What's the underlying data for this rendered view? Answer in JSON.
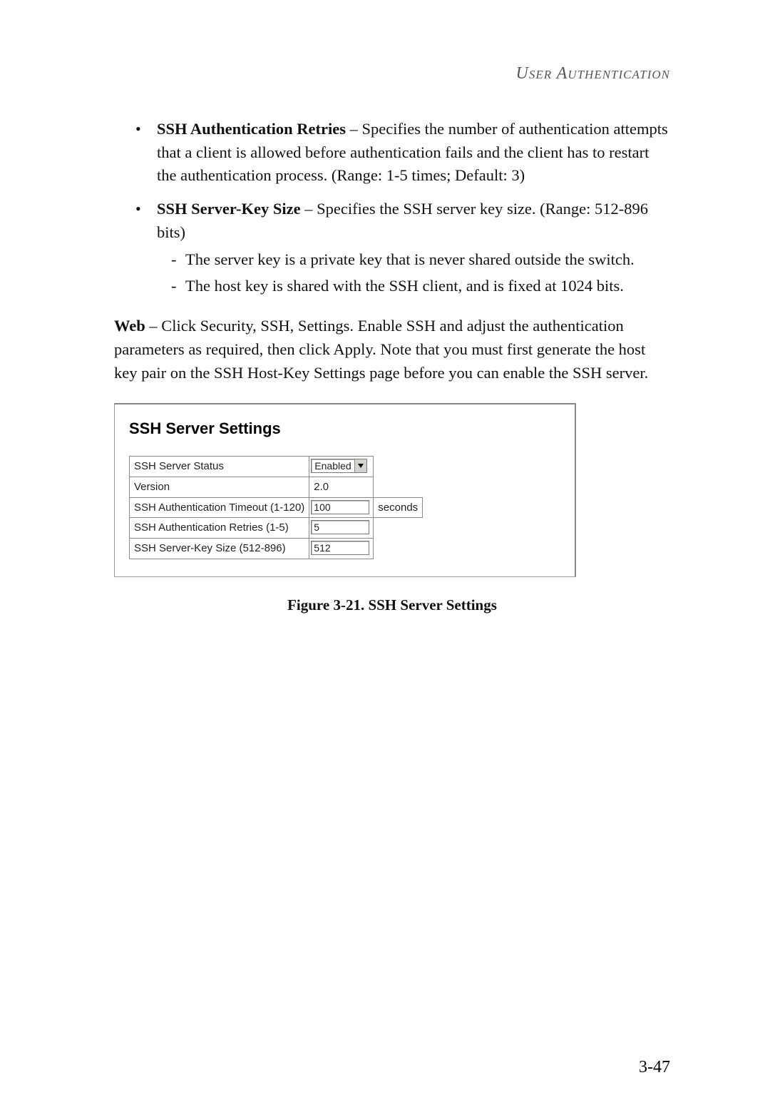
{
  "header": {
    "title": "User Authentication"
  },
  "bullets": {
    "b1": {
      "strong": "SSH Authentication Retries",
      "rest": " – Specifies the number of authentication attempts that a client is allowed before authentication fails and the client has to restart the authentication process. (Range: 1-5 times; Default: 3)"
    },
    "b2": {
      "strong": "SSH Server-Key Size",
      "rest": " – Specifies the SSH server key size. (Range: 512-896 bits)",
      "sub1": "The server key is a private key that is never shared outside the switch.",
      "sub2": "The host key is shared with the SSH client, and is fixed at 1024 bits."
    }
  },
  "web_para": {
    "strong": "Web",
    "rest": " – Click Security, SSH, Settings. Enable SSH and adjust the authentication parameters as required, then click Apply. Note that you must first generate the host key pair on the SSH Host-Key Settings page before you can enable the SSH server."
  },
  "panel": {
    "title": "SSH Server Settings",
    "rows": {
      "r1": {
        "label": "SSH Server Status",
        "value": "Enabled"
      },
      "r2": {
        "label": "Version",
        "value": "2.0"
      },
      "r3": {
        "label": "SSH Authentication Timeout (1-120)",
        "value": "100",
        "unit": "seconds"
      },
      "r4": {
        "label": "SSH Authentication Retries (1-5)",
        "value": "5"
      },
      "r5": {
        "label": "SSH Server-Key Size (512-896)",
        "value": "512"
      }
    }
  },
  "caption": "Figure 3-21.  SSH Server Settings",
  "page_number": "3-47"
}
